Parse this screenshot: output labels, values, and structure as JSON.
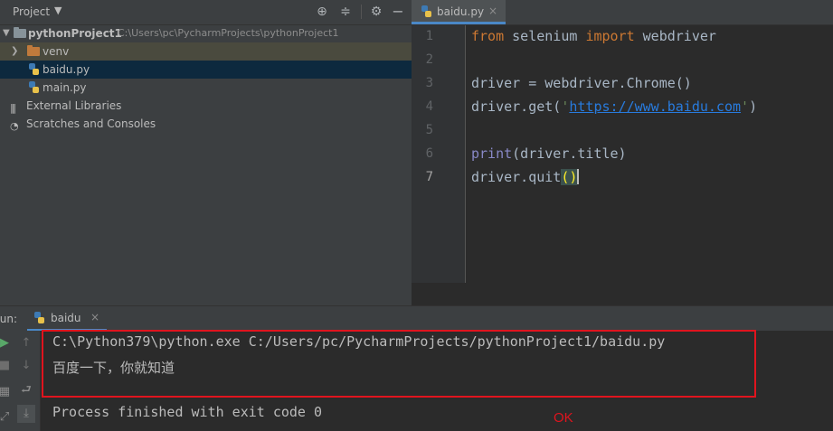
{
  "project_panel": {
    "title": "Project",
    "tree": [
      {
        "label": "pythonProject1",
        "path": "C:\\Users\\pc\\PycharmProjects\\pythonProject1"
      },
      {
        "label": "venv"
      },
      {
        "label": "baidu.py"
      },
      {
        "label": "main.py"
      },
      {
        "label": "External Libraries"
      },
      {
        "label": "Scratches and Consoles"
      }
    ]
  },
  "editor": {
    "tab_label": "baidu.py",
    "line_numbers": [
      "1",
      "2",
      "3",
      "4",
      "5",
      "6",
      "7"
    ],
    "code": {
      "l1_kw1": "from",
      "l1_mid": " selenium ",
      "l1_kw2": "import",
      "l1_end": " webdriver",
      "l3": "driver = webdriver.Chrome()",
      "l4_pre": "driver.get(",
      "l4_q1": "'",
      "l4_url": "https://www.baidu.com",
      "l4_q2": "'",
      "l4_post": ")",
      "l6_print": "print",
      "l6_rest": "(driver.title)",
      "l7_pre": "driver.quit",
      "l7_paren": "()"
    }
  },
  "run_panel": {
    "label": "Run:",
    "tab_label": "baidu",
    "console_lines": [
      "C:\\Python379\\python.exe C:/Users/pc/PycharmProjects/pythonProject1/baidu.py",
      "百度一下，你就知道",
      "Process finished with exit code 0"
    ],
    "annotation": "OK",
    "annotation_color": "#e0141e"
  }
}
